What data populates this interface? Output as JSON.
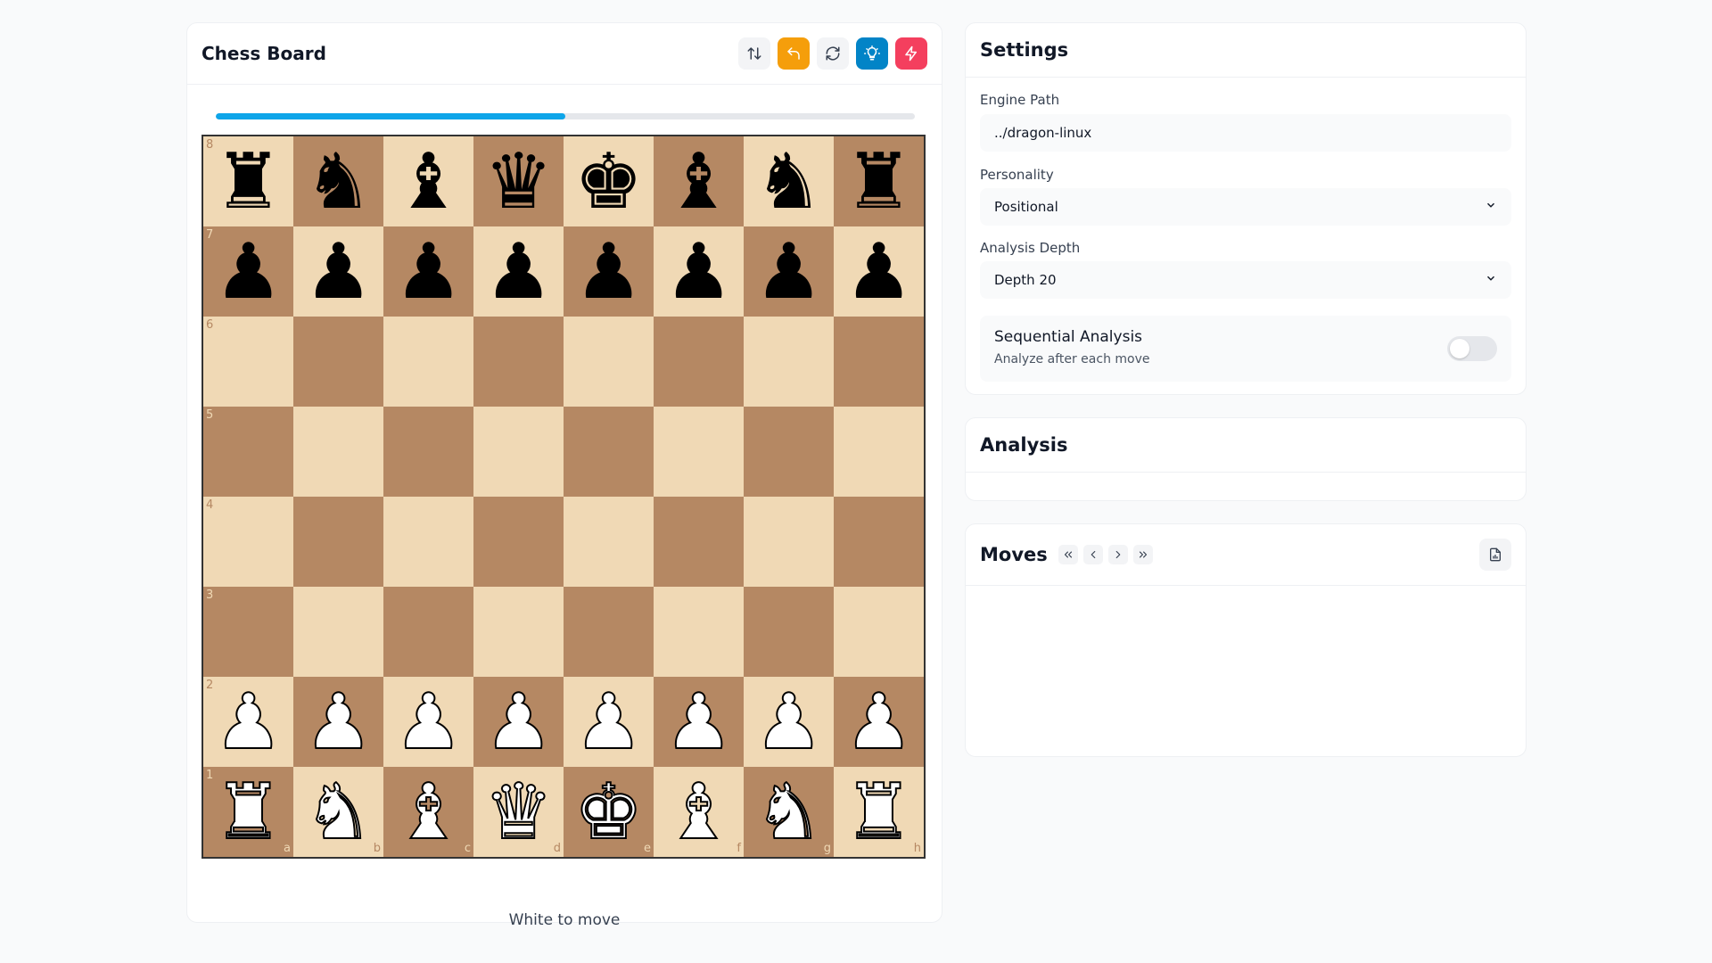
{
  "board_panel": {
    "title": "Chess Board",
    "analysis_progress": 0.5,
    "turn_text": "White to move",
    "tools": [
      "flip-board-icon",
      "undo-icon",
      "reset-icon",
      "hint-icon",
      "best-move-icon"
    ]
  },
  "board": {
    "ranks": [
      "8",
      "7",
      "6",
      "5",
      "4",
      "3",
      "2",
      "1"
    ],
    "files": [
      "a",
      "b",
      "c",
      "d",
      "e",
      "f",
      "g",
      "h"
    ],
    "position": [
      [
        "bR",
        "bN",
        "bB",
        "bQ",
        "bK",
        "bB",
        "bN",
        "bR"
      ],
      [
        "bP",
        "bP",
        "bP",
        "bP",
        "bP",
        "bP",
        "bP",
        "bP"
      ],
      [
        "",
        "",
        "",
        "",
        "",
        "",
        "",
        ""
      ],
      [
        "",
        "",
        "",
        "",
        "",
        "",
        "",
        ""
      ],
      [
        "",
        "",
        "",
        "",
        "",
        "",
        "",
        ""
      ],
      [
        "",
        "",
        "",
        "",
        "",
        "",
        "",
        ""
      ],
      [
        "wP",
        "wP",
        "wP",
        "wP",
        "wP",
        "wP",
        "wP",
        "wP"
      ],
      [
        "wR",
        "wN",
        "wB",
        "wQ",
        "wK",
        "wB",
        "wN",
        "wR"
      ]
    ],
    "colors": {
      "light": "#f0d9b5",
      "dark": "#b58863"
    }
  },
  "settings": {
    "title": "Settings",
    "engine_path_label": "Engine Path",
    "engine_path_value": "../dragon-linux",
    "personality_label": "Personality",
    "personality_value": "Positional",
    "depth_label": "Analysis Depth",
    "depth_value": "Depth 20",
    "sequential_title": "Sequential Analysis",
    "sequential_subtitle": "Analyze after each move",
    "sequential_enabled": false
  },
  "analysis": {
    "title": "Analysis"
  },
  "moves": {
    "title": "Moves"
  },
  "colors": {
    "accent": "#0ea5e9",
    "undo": "#f59e0b",
    "hint": "#0284c7",
    "best": "#f43f5e"
  }
}
